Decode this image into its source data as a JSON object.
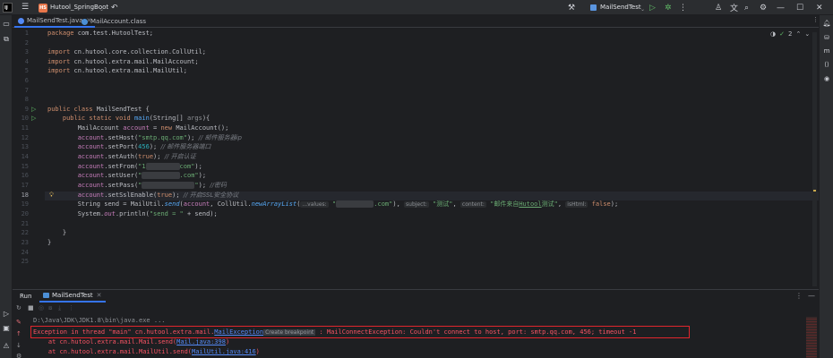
{
  "titlebar": {
    "logo_text": "IJ",
    "project_badge": "HS",
    "project_name": "Hutool_SpringBoot",
    "run_config": "MailSendTest",
    "icons": [
      "hamburger-icon",
      "vcs-icon",
      "hammer-icon",
      "run-icon",
      "debug-icon",
      "more-icon",
      "user-icon",
      "translate-icon",
      "search-icon",
      "gear-icon",
      "minimize-icon",
      "maximize-icon",
      "close-icon"
    ]
  },
  "tabs": [
    {
      "label": "MailSendTest.java",
      "active": true
    },
    {
      "label": "MailAccount.class",
      "active": false
    }
  ],
  "editor": {
    "inspection_count": "2",
    "lines": [
      "1",
      "2",
      "3",
      "4",
      "5",
      "6",
      "7",
      "8",
      "9",
      "10",
      "11",
      "12",
      "13",
      "14",
      "15",
      "16",
      "17",
      "18",
      "19",
      "20",
      "21",
      "22",
      "23",
      "24",
      "25"
    ],
    "code": {
      "l1_kw": "package",
      "l1_rest": " com.test.HutoolTest;",
      "l3_kw": "import",
      "l3_rest": " cn.hutool.core.collection.CollUtil;",
      "l4_kw": "import",
      "l4_rest": " cn.hutool.extra.mail.MailAccount;",
      "l5_kw": "import",
      "l5_rest": " cn.hutool.extra.mail.MailUtil;",
      "l9_kw": "public class",
      "l9_rest": " MailSendTest {",
      "l10_kw": "public static void",
      "l10_fn": "main",
      "l10_rest": "(String[] ",
      "l10_arg": "args",
      "l10_end": "){",
      "l11_a": "MailAccount ",
      "l11_var": "account",
      "l11_b": " = ",
      "l11_kw": "new",
      "l11_c": " MailAccount();",
      "l12_var": "account",
      "l12_a": ".setHost(",
      "l12_str": "\"smtp.qq.com\"",
      "l12_b": "); ",
      "l12_cmt": "// 邮件服务器ip",
      "l13_var": "account",
      "l13_a": ".setPort(",
      "l13_num": "456",
      "l13_b": "); ",
      "l13_cmt": "// 邮件服务器端口",
      "l14_var": "account",
      "l14_a": ".setAuth(",
      "l14_kw": "true",
      "l14_b": "); ",
      "l14_cmt": "// 开启认证",
      "l15_var": "account",
      "l15_a": ".setFrom(",
      "l15_str1": "\"1",
      "l15_str2": "com\"",
      "l15_b": ");",
      "l16_var": "account",
      "l16_a": ".setUser(",
      "l16_str1": "\"",
      "l16_str2": ".com\"",
      "l16_b": ");",
      "l17_var": "account",
      "l17_a": ".setPass(",
      "l17_str1": "\"",
      "l17_str2": "\"",
      "l17_b": "); ",
      "l17_cmt": "//密码",
      "l18_var": "account",
      "l18_a": ".setSslEnable(",
      "l18_kw": "true",
      "l18_b": "); ",
      "l18_cmt": "// 开启SSL安全协议",
      "l19_a": "String ",
      "l19_var": "send",
      "l19_b": " = MailUtil.",
      "l19_fn": "send",
      "l19_c": "(",
      "l19_acc": "account",
      "l19_d": ", CollUtil.",
      "l19_fn2": "newArrayList",
      "l19_e": "(",
      "l19_h1": "...values:",
      "l19_str1": "\"",
      "l19_str2": ".com\"",
      "l19_f": "), ",
      "l19_h2": "subject:",
      "l19_str3": "\"测试\"",
      "l19_g": ", ",
      "l19_h3": "content:",
      "l19_str4a": "\"邮件来自",
      "l19_str4b": "Hutool",
      "l19_str4c": "测试\"",
      "l19_h": ", ",
      "l19_h4": "isHtml:",
      "l19_kw": "false",
      "l19_i": ");",
      "l20_a": "System.",
      "l20_out": "out",
      "l20_b": ".println(",
      "l20_str": "\"send = \"",
      "l20_c": " + ",
      "l20_var": "send",
      "l20_d": ");",
      "l22": "}",
      "l23": "}"
    }
  },
  "run_panel": {
    "label": "Run",
    "tab": "MailSendTest",
    "console": {
      "line1": "D:\\Java\\JDK\\JDK1.8\\bin\\java.exe ...",
      "line2_a": "Exception in thread \"main\" cn.hutool.extra.mail.",
      "line2_link": "MailException",
      "line2_hint": "Create breakpoint",
      "line2_b": " : MailConnectException: Couldn't connect to host, port: smtp.qq.com, 456; timeout -1",
      "line3_a": "    at cn.hutool.extra.mail.Mail.send(",
      "line3_link": "Mail.java:398",
      "line3_b": ")",
      "line4_a": "    at cn.hutool.extra.mail.MailUtil.send(",
      "line4_link": "MailUtil.java:416",
      "line4_b": ")"
    }
  },
  "colors": {
    "error": "#f75464",
    "highlight_box": "#e0262d",
    "accent": "#3574f0"
  }
}
